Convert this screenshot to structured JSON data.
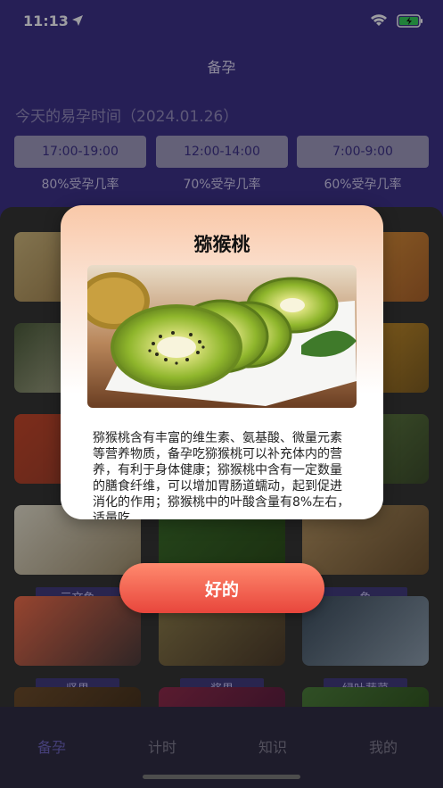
{
  "status_bar": {
    "time": "11:13"
  },
  "header": {
    "title": "备孕",
    "today_label": "今天的易孕时间（2024.01.26）",
    "slots": [
      {
        "time": "17:00-19:00",
        "rate": "80%受孕几率"
      },
      {
        "time": "12:00-14:00",
        "rate": "70%受孕几率"
      },
      {
        "time": "7:00-9:00",
        "rate": "60%受孕几率"
      }
    ]
  },
  "food_tags": {
    "salmon": "三文鱼",
    "fish": "鱼",
    "nuts": "坚果",
    "berries": "浆果",
    "greens": "绿叶蔬菜"
  },
  "modal": {
    "title": "猕猴桃",
    "image": "kiwi-fruit-slices",
    "description": "猕猴桃含有丰富的维生素、氨基酸、微量元素等营养物质，备孕吃猕猴桃可以补充体内的营养，有利于身体健康；猕猴桃中含有一定数量的膳食纤维，可以增加胃肠道蠕动，起到促进消化的作用；猕猴桃中的叶酸含量有8%左右，适量吃",
    "ok_label": "好的"
  },
  "tabbar": {
    "tabs": [
      {
        "label": "备孕",
        "active": true
      },
      {
        "label": "计时",
        "active": false
      },
      {
        "label": "知识",
        "active": false
      },
      {
        "label": "我的",
        "active": false
      }
    ]
  }
}
